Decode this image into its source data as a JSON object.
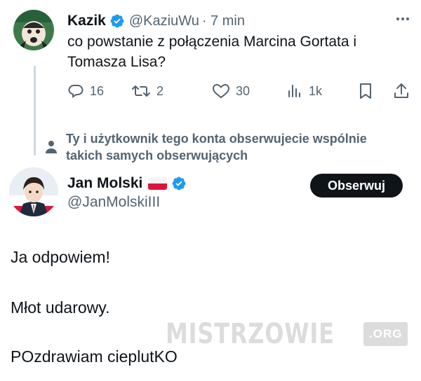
{
  "tweet1": {
    "author_name": "Kazik",
    "handle": "@KaziuWu",
    "time": "· 7 min",
    "text": "co powstanie z połączenia Marcina Gortata i Tomasza Lisa?",
    "actions": {
      "replies": "16",
      "retweets": "2",
      "likes": "30",
      "views": "1k"
    },
    "icons": [
      "verified-badge-icon",
      "more-icon",
      "reply-icon",
      "retweet-icon",
      "like-icon",
      "views-icon",
      "bookmark-icon",
      "share-icon"
    ]
  },
  "mutual_notice": {
    "text": "Ty i użytkownik tego konta obserwujecie wspólnie takich samych obserwujących",
    "icon": "person-icon"
  },
  "tweet2": {
    "author_name": "Jan Molski",
    "handle": "@JanMolskiIII",
    "follow_label": "Obserwuj",
    "lines": [
      "Ja odpowiem!",
      "Młot udarowy.",
      "POzdrawiam cieplutKO"
    ]
  },
  "watermark": {
    "text": "MISTRZOWIE",
    "suffix": ".ORG"
  },
  "colors": {
    "verified": "#1d9bf0",
    "muted": "#536471",
    "text": "#0f1419",
    "follow_bg": "#0f1419",
    "thread_line": "#cfd9de"
  }
}
